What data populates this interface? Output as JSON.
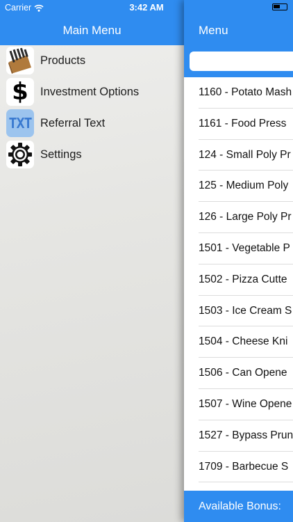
{
  "status": {
    "carrier": "Carrier",
    "time": "3:42 AM"
  },
  "side_menu": {
    "title": "Main Menu",
    "items": [
      {
        "label": "Products",
        "icon": "knife-block-icon"
      },
      {
        "label": "Investment Options",
        "icon": "dollar-icon"
      },
      {
        "label": "Referral Text",
        "icon": "txt-icon",
        "icon_text": "TXT"
      },
      {
        "label": "Settings",
        "icon": "gear-icon"
      }
    ]
  },
  "panel": {
    "title": "Menu",
    "search_placeholder": "",
    "products": [
      "1160 - Potato Mash",
      "1161 - Food Press",
      "124 - Small Poly Pr",
      "125 - Medium Poly",
      "126 - Large Poly Pr",
      "1501 - Vegetable P",
      "1502 - Pizza Cutte",
      "1503 - Ice Cream S",
      "1504 - Cheese Kni",
      "1506 - Can Opene",
      "1507 - Wine Opene",
      "1527 - Bypass Prun",
      "1709 - Barbecue S"
    ],
    "bonus_label": "Available Bonus:"
  },
  "colors": {
    "accent": "#2f8cf0",
    "menu_background": "#e6e6e3",
    "separator": "#dcdcdc"
  }
}
